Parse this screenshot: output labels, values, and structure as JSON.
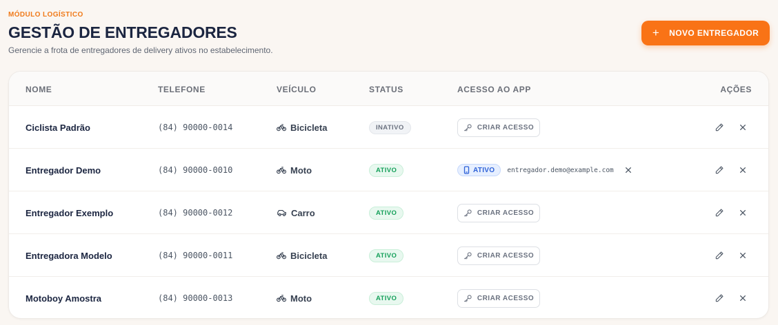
{
  "header": {
    "eyebrow": "MÓDULO LOGÍSTICO",
    "title": "GESTÃO DE ENTREGADORES",
    "subtitle": "Gerencie a frota de entregadores de delivery ativos no estabelecimento.",
    "new_button_label": "NOVO ENTREGADOR"
  },
  "colors": {
    "accent": "#f97316",
    "active": "#15a05a",
    "inactive": "#6b7280",
    "app_badge": "#2f62d8"
  },
  "table": {
    "columns": {
      "name": "NOME",
      "phone": "TELEFONE",
      "vehicle": "VEÍCULO",
      "status": "STATUS",
      "access": "ACESSO AO APP",
      "actions": "AÇÕES"
    },
    "rows": [
      {
        "name": "Ciclista Padrão",
        "phone": "(84) 90000-0014",
        "vehicle": "Bicicleta",
        "vehicle_icon": "bicycle-icon",
        "status": "INATIVO",
        "status_kind": "inactive",
        "access_kind": "button",
        "access_label": "CRIAR ACESSO"
      },
      {
        "name": "Entregador Demo",
        "phone": "(84) 90000-0010",
        "vehicle": "Moto",
        "vehicle_icon": "bicycle-icon",
        "status": "ATIVO",
        "status_kind": "active",
        "access_kind": "granted",
        "access_label": "ATIVO",
        "access_email": "entregador.demo@example.com"
      },
      {
        "name": "Entregador Exemplo",
        "phone": "(84) 90000-0012",
        "vehicle": "Carro",
        "vehicle_icon": "car-icon",
        "status": "ATIVO",
        "status_kind": "active",
        "access_kind": "button",
        "access_label": "CRIAR ACESSO"
      },
      {
        "name": "Entregadora Modelo",
        "phone": "(84) 90000-0011",
        "vehicle": "Bicicleta",
        "vehicle_icon": "bicycle-icon",
        "status": "ATIVO",
        "status_kind": "active",
        "access_kind": "button",
        "access_label": "CRIAR ACESSO"
      },
      {
        "name": "Motoboy Amostra",
        "phone": "(84) 90000-0013",
        "vehicle": "Moto",
        "vehicle_icon": "bicycle-icon",
        "status": "ATIVO",
        "status_kind": "active",
        "access_kind": "button",
        "access_label": "CRIAR ACESSO"
      }
    ]
  }
}
